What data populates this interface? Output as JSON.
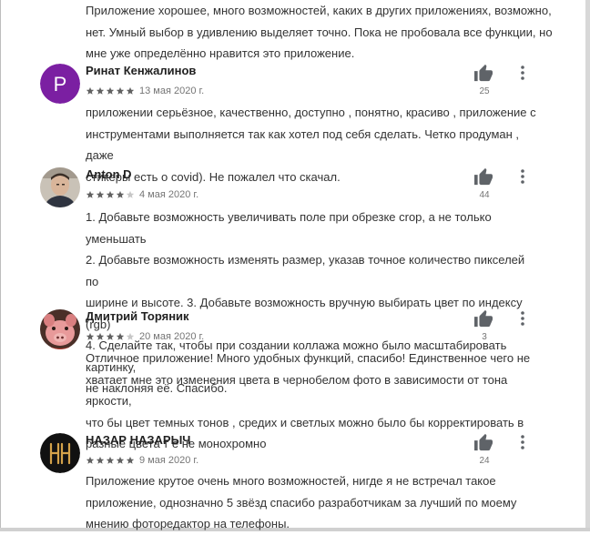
{
  "intro_review": {
    "lines": [
      "Приложение хорошее, много возможностей, каких в других приложениях, возможно,",
      "нет. Умный выбор в удивлению выделяет точно. Пока не пробовала все функции, но",
      "мне уже определённо нравится это приложение."
    ]
  },
  "colors": {
    "star_filled": "#616161",
    "star_empty": "#c7c7c7",
    "icon": "#5f6368",
    "avatar_purple": "#7b1fa2"
  },
  "reviews": [
    {
      "author": "Ринат Кенжалинов",
      "avatar_letter": "Р",
      "rating": 5,
      "date": "13 мая 2020 г.",
      "likes": "25",
      "lines": [
        "приложении серьёзное, качественно, доступно , понятно, красиво , приложение с",
        "инструментами выполняется так как хотел под себя сделать. Четко продуман , даже",
        "стикеры есть о covid). Не пожалел что скачал."
      ]
    },
    {
      "author": "Anton D",
      "avatar_letter": "",
      "rating": 4,
      "date": "4 мая 2020 г.",
      "likes": "44",
      "lines": [
        "1. Добавьте возможность увеличивать поле при обрезке crop, а не только уменьшать",
        "2. Добавьте возможность изменять размер, указав точное количество пикселей по",
        "ширине и высоте. 3. Добавьте возможность вручную выбирать цвет по индексу (rgb)",
        "4. Сделайте так, чтобы при создании коллажа можно было масштабировать картинку,",
        "не наклоняя её. Спасибо."
      ]
    },
    {
      "author": "Дмитрий Торяник",
      "avatar_letter": "",
      "rating": 4,
      "date": "20 мая 2020 г.",
      "likes": "3",
      "lines": [
        "Отличное приложение! Много удобных функций, спасибо! Единственное чего не",
        "хватает мне это изменения цвета в чернобелом фото в зависимости от тона яркости,",
        "что бы цвет темных тонов , средих и светлых можно было бы корректировать в",
        "разные цвета т е не монохромно"
      ]
    },
    {
      "author": "НАЗАР НАЗАРЫЧ",
      "avatar_letter": "",
      "rating": 5,
      "date": "9 мая 2020 г.",
      "likes": "24",
      "lines": [
        "Приложение крутое очень много возможностей, нигде я не встречал такое",
        "приложение, однозначно 5 звёзд спасибо разработчикам за лучший по моему",
        "мнению фоторедактор на телефоны."
      ]
    }
  ]
}
